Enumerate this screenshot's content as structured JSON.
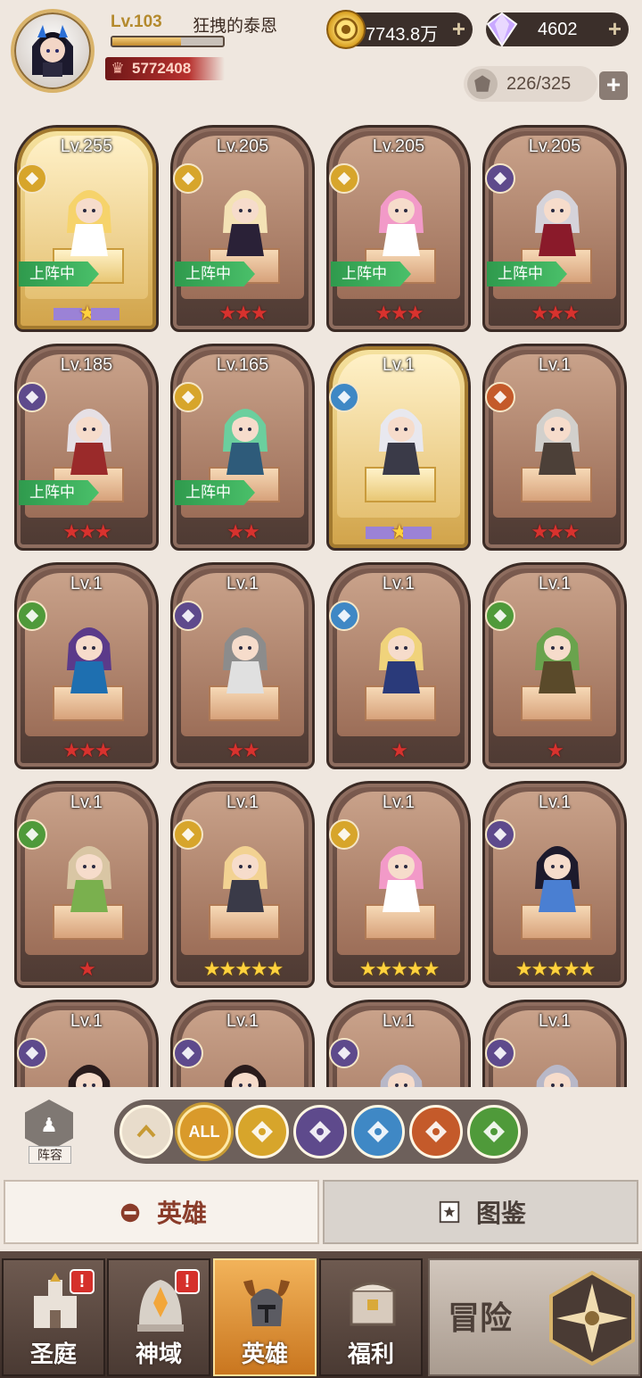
{
  "player": {
    "level": "Lv.103",
    "name": "狂拽的泰恩",
    "xp_fraction": 0.62,
    "power": "5772408"
  },
  "currency": {
    "gold": "7743.8万",
    "gems": "4602"
  },
  "hero_capacity": "226/325",
  "heroes": [
    {
      "level": "Lv.255",
      "faction": "light",
      "deployed": true,
      "deploy_label": "上阵中",
      "rank": "purple-1",
      "stars": "★",
      "card": "gold"
    },
    {
      "level": "Lv.205",
      "faction": "light",
      "deployed": true,
      "deploy_label": "上阵中",
      "rank": "red-3",
      "stars": "★★★",
      "card": "normal"
    },
    {
      "level": "Lv.205",
      "faction": "light",
      "deployed": true,
      "deploy_label": "上阵中",
      "rank": "red-3",
      "stars": "★★★",
      "card": "normal"
    },
    {
      "level": "Lv.205",
      "faction": "dark",
      "deployed": true,
      "deploy_label": "上阵中",
      "rank": "red-3",
      "stars": "★★★",
      "card": "normal"
    },
    {
      "level": "Lv.185",
      "faction": "dark",
      "deployed": true,
      "deploy_label": "上阵中",
      "rank": "red-3",
      "stars": "★★★",
      "card": "normal"
    },
    {
      "level": "Lv.165",
      "faction": "light",
      "deployed": true,
      "deploy_label": "上阵中",
      "rank": "red-2",
      "stars": "★★",
      "card": "normal"
    },
    {
      "level": "Lv.1",
      "faction": "order",
      "deployed": false,
      "rank": "purple-1",
      "stars": "★",
      "card": "gold"
    },
    {
      "level": "Lv.1",
      "faction": "beast",
      "deployed": false,
      "rank": "red-3",
      "stars": "★★★",
      "card": "normal"
    },
    {
      "level": "Lv.1",
      "faction": "nature",
      "deployed": false,
      "rank": "red-3",
      "stars": "★★★",
      "card": "normal"
    },
    {
      "level": "Lv.1",
      "faction": "dark",
      "deployed": false,
      "rank": "red-2",
      "stars": "★★",
      "card": "normal"
    },
    {
      "level": "Lv.1",
      "faction": "order",
      "deployed": false,
      "rank": "red-1",
      "stars": "★",
      "card": "normal"
    },
    {
      "level": "Lv.1",
      "faction": "nature",
      "deployed": false,
      "rank": "red-1",
      "stars": "★",
      "card": "normal"
    },
    {
      "level": "Lv.1",
      "faction": "nature",
      "deployed": false,
      "rank": "red-1",
      "stars": "★",
      "card": "normal"
    },
    {
      "level": "Lv.1",
      "faction": "light",
      "deployed": false,
      "rank": "gold-5",
      "stars": "★★★★★",
      "card": "normal"
    },
    {
      "level": "Lv.1",
      "faction": "light",
      "deployed": false,
      "rank": "gold-5",
      "stars": "★★★★★",
      "card": "normal"
    },
    {
      "level": "Lv.1",
      "faction": "dark",
      "deployed": false,
      "rank": "gold-5",
      "stars": "★★★★★",
      "card": "normal"
    },
    {
      "level": "Lv.1",
      "faction": "dark",
      "deployed": false,
      "rank": "",
      "stars": "",
      "card": "normal"
    },
    {
      "level": "Lv.1",
      "faction": "dark",
      "deployed": false,
      "rank": "",
      "stars": "",
      "card": "normal"
    },
    {
      "level": "Lv.1",
      "faction": "dark",
      "deployed": false,
      "rank": "",
      "stars": "",
      "card": "normal"
    },
    {
      "level": "Lv.1",
      "faction": "dark",
      "deployed": false,
      "rank": "",
      "stars": "",
      "card": "normal"
    }
  ],
  "faction_colors": {
    "light": "#d7a52b",
    "dark": "#5e4a8c",
    "order": "#3f88c5",
    "beast": "#c45a2a",
    "nature": "#4f9a3a"
  },
  "filter": {
    "lineup_label": "阵容",
    "all_label": "ALL",
    "buttons": [
      {
        "id": "up",
        "icon": "chevron-up-icon",
        "color": "#e8dccb"
      },
      {
        "id": "all",
        "icon": "all-text",
        "color": "#d99a2b",
        "selected": true
      },
      {
        "id": "light",
        "icon": "light-faction-icon",
        "color": "#d7a52b"
      },
      {
        "id": "dark",
        "icon": "dark-faction-icon",
        "color": "#5e4a8c"
      },
      {
        "id": "order",
        "icon": "order-faction-icon",
        "color": "#3f88c5"
      },
      {
        "id": "beast",
        "icon": "beast-faction-icon",
        "color": "#c45a2a"
      },
      {
        "id": "nature",
        "icon": "nature-faction-icon",
        "color": "#4f9a3a"
      }
    ]
  },
  "tabs": {
    "heroes": "英雄",
    "codex": "图鉴"
  },
  "nav": {
    "courtyard": "圣庭",
    "divine_realm": "神域",
    "heroes": "英雄",
    "welfare": "福利",
    "adventure": "冒险",
    "badge": "!"
  }
}
